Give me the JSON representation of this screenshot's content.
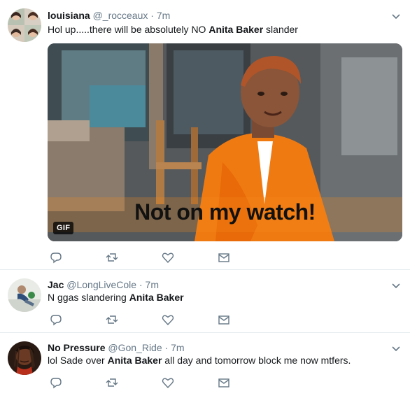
{
  "tweets": [
    {
      "name": "louisiana",
      "handle": "@_rocceaux",
      "dot": "·",
      "time": "7m",
      "text_before": "Hol up.....there will be absolutely NO ",
      "text_bold": "Anita Baker",
      "text_after": " slander",
      "gif_caption": "Not on my watch!",
      "gif_badge": "GIF"
    },
    {
      "name": "Jac",
      "handle": "@LongLiveCole",
      "dot": "·",
      "time": "7m",
      "text_before": "N ggas slandering ",
      "text_bold": "Anita Baker",
      "text_after": ""
    },
    {
      "name": "No Pressure",
      "handle": "@Gon_Ride",
      "dot": "·",
      "time": "7m",
      "text_before": "lol Sade over ",
      "text_bold": "Anita Baker",
      "text_after": " all day and tomorrow block me now mtfers."
    }
  ],
  "icons": {
    "reply": "reply-icon",
    "retweet": "retweet-icon",
    "like": "heart-icon",
    "dm": "envelope-icon",
    "caret": "chevron-down-icon"
  },
  "colors": {
    "text": "#14171a",
    "secondary": "#657786",
    "divider": "#e6ecf0"
  }
}
